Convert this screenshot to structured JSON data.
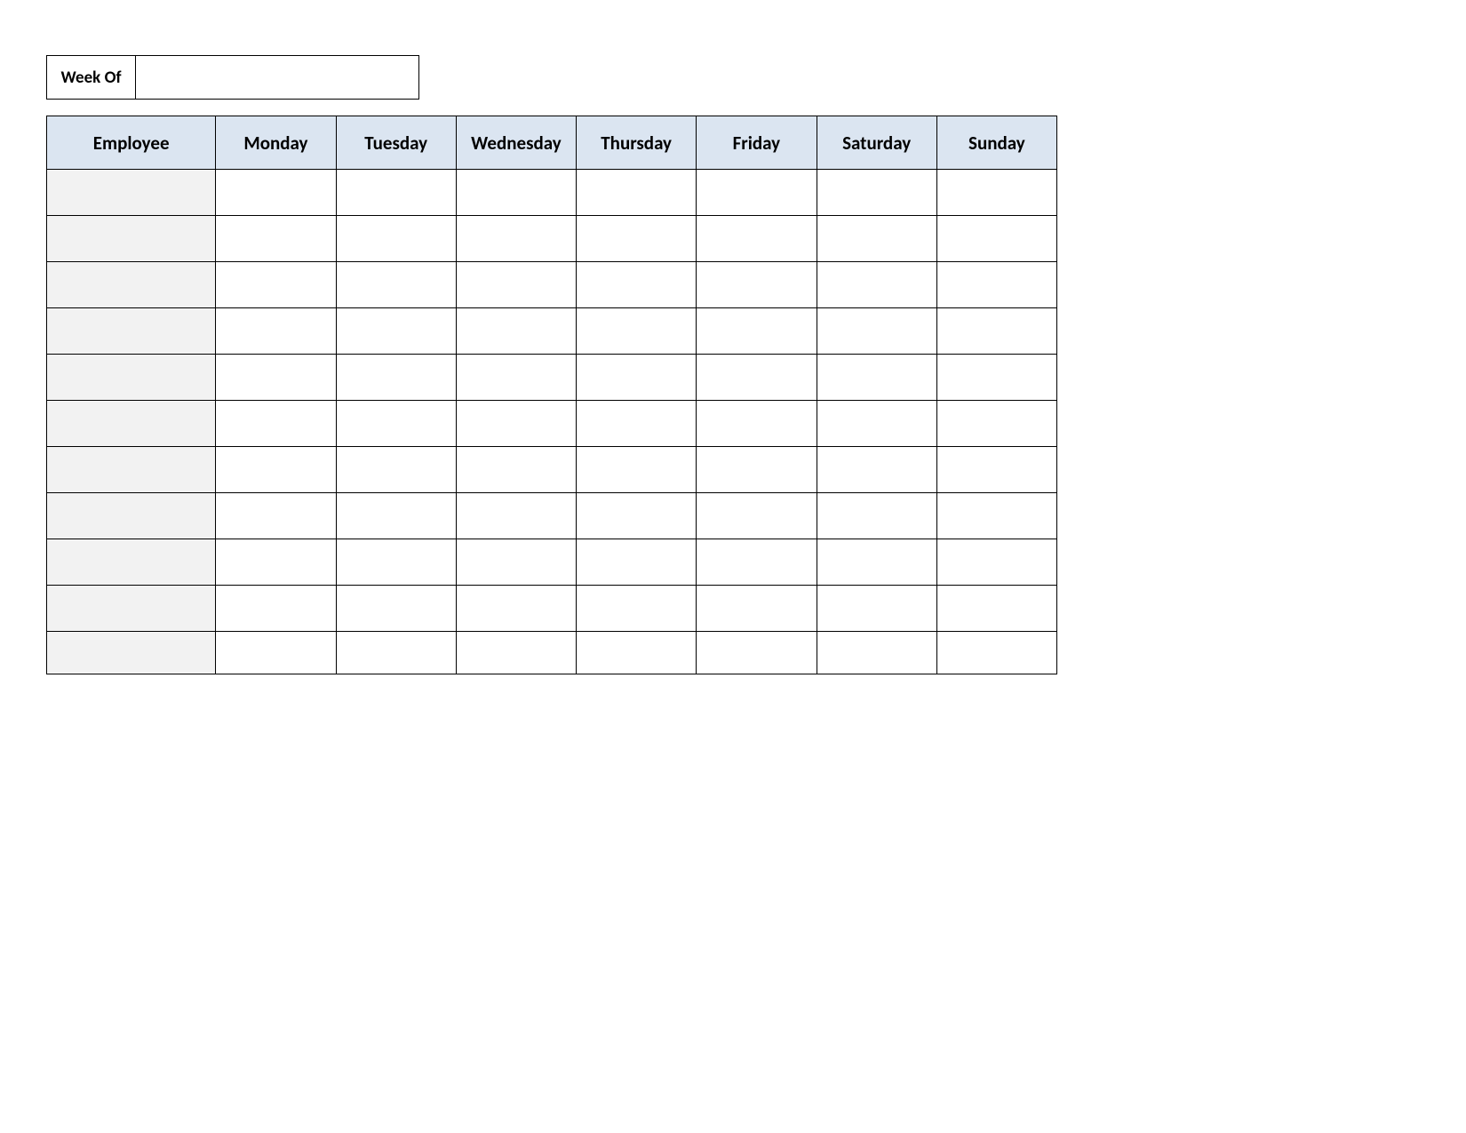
{
  "week_of": {
    "label": "Week Of",
    "value": ""
  },
  "columns": [
    "Employee",
    "Monday",
    "Tuesday",
    "Wednesday",
    "Thursday",
    "Friday",
    "Saturday",
    "Sunday"
  ],
  "rows": [
    {
      "employee": "",
      "mon": "",
      "tue": "",
      "wed": "",
      "thu": "",
      "fri": "",
      "sat": "",
      "sun": ""
    },
    {
      "employee": "",
      "mon": "",
      "tue": "",
      "wed": "",
      "thu": "",
      "fri": "",
      "sat": "",
      "sun": ""
    },
    {
      "employee": "",
      "mon": "",
      "tue": "",
      "wed": "",
      "thu": "",
      "fri": "",
      "sat": "",
      "sun": ""
    },
    {
      "employee": "",
      "mon": "",
      "tue": "",
      "wed": "",
      "thu": "",
      "fri": "",
      "sat": "",
      "sun": ""
    },
    {
      "employee": "",
      "mon": "",
      "tue": "",
      "wed": "",
      "thu": "",
      "fri": "",
      "sat": "",
      "sun": ""
    },
    {
      "employee": "",
      "mon": "",
      "tue": "",
      "wed": "",
      "thu": "",
      "fri": "",
      "sat": "",
      "sun": ""
    },
    {
      "employee": "",
      "mon": "",
      "tue": "",
      "wed": "",
      "thu": "",
      "fri": "",
      "sat": "",
      "sun": ""
    },
    {
      "employee": "",
      "mon": "",
      "tue": "",
      "wed": "",
      "thu": "",
      "fri": "",
      "sat": "",
      "sun": ""
    },
    {
      "employee": "",
      "mon": "",
      "tue": "",
      "wed": "",
      "thu": "",
      "fri": "",
      "sat": "",
      "sun": ""
    },
    {
      "employee": "",
      "mon": "",
      "tue": "",
      "wed": "",
      "thu": "",
      "fri": "",
      "sat": "",
      "sun": ""
    },
    {
      "employee": "",
      "mon": "",
      "tue": "",
      "wed": "",
      "thu": "",
      "fri": "",
      "sat": "",
      "sun": ""
    }
  ]
}
